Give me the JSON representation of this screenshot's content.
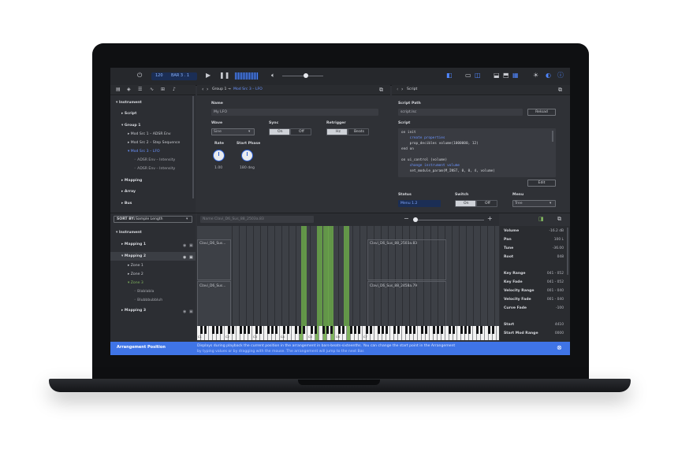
{
  "toolbar": {
    "tempo": "120",
    "signature": "BAR  3 . 1",
    "play_icon": "play-icon",
    "pause_icon": "pause-icon"
  },
  "sidebar_top": {
    "items": [
      {
        "label": "Instrument",
        "level": 0
      },
      {
        "label": "Script",
        "level": 1
      },
      {
        "label": "Group 1",
        "level": 1
      },
      {
        "label": "Mod Src 1 – ADSR Env",
        "level": 2
      },
      {
        "label": "Mod Src 2 – Step Sequence",
        "level": 2
      },
      {
        "label": "Mod Src 3 – LFO",
        "level": 2
      },
      {
        "label": "ADSR Env – Intensity",
        "level": 3
      },
      {
        "label": "ADSR Env – Intensity",
        "level": 3
      },
      {
        "label": "Mapping",
        "level": 1
      },
      {
        "label": "Array",
        "level": 1
      },
      {
        "label": "Bus",
        "level": 1
      }
    ]
  },
  "editor": {
    "breadcrumb_group": "Group 1",
    "breadcrumb_arrow": "→",
    "breadcrumb_item": "Mod Src 3 – LFO",
    "name_label": "Name",
    "name_value": "My LFO",
    "wave_label": "Wave",
    "wave_value": "Sine",
    "sync_label": "Sync",
    "sync_on": "On",
    "sync_off": "Off",
    "retrigger_label": "Retrigger",
    "retrigger_hz": "Hz",
    "retrigger_beats": "Beats",
    "rate_label": "Rate",
    "rate_value": "1.00",
    "start_phase_label": "Start Phase",
    "start_phase_value": "180 deg"
  },
  "script_panel": {
    "title": "Script",
    "path_label": "Script Path",
    "path_value": "script.lsc",
    "reload_label": "Reload",
    "script_label": "Script",
    "code": [
      {
        "text": "on init",
        "comment": false
      },
      {
        "text": "    create properties",
        "comment": true
      },
      {
        "text": "    prop_decibles volume(1000000, 12)",
        "comment": false
      },
      {
        "text": "end on",
        "comment": false
      },
      {
        "text": "",
        "comment": false
      },
      {
        "text": "on ui_control (volume)",
        "comment": false
      },
      {
        "text": "    change instrument volume",
        "comment": true
      },
      {
        "text": "    set_module_param(M_INST, 0, 0, 4, volume)",
        "comment": false
      }
    ],
    "edit_label": "Edit",
    "status_label": "Status",
    "status_value": "Menu 1.2",
    "switch_label": "Switch",
    "switch_on": "On",
    "switch_off": "Off",
    "menu_label": "Menu",
    "menu_value": "Tree"
  },
  "sort": {
    "label": "SORT BY:",
    "value": "Sample Length"
  },
  "sidebar_bottom": {
    "items": [
      {
        "label": "Instrument",
        "level": 0
      },
      {
        "label": "Mapping 1",
        "level": 1
      },
      {
        "label": "Mapping 2",
        "level": 1
      },
      {
        "label": "Zone 1",
        "level": 2
      },
      {
        "label": "Zone 2",
        "level": 2
      },
      {
        "label": "Zone 3",
        "level": 2
      },
      {
        "label": "Blablabla",
        "level": 3
      },
      {
        "label": "Blubbbubbluh",
        "level": 3
      },
      {
        "label": "Mapping 3",
        "level": 1
      }
    ]
  },
  "mapping": {
    "name_field": "Name  Clavi_D6_Sus_88_2503a.83",
    "zones": [
      "Clavi_D6_Sus...",
      "Clavi_D6_Sus_88_2503a.83",
      "Clavi_D6_Sus...",
      "Clavi_D6_Sus_88_2458a.79"
    ],
    "key_labels": [
      "C1",
      "C2",
      "C3",
      "C4",
      "C5",
      "C6",
      "C7"
    ]
  },
  "properties": {
    "items": [
      {
        "label": "Volume",
        "value": "-16.2 dB"
      },
      {
        "label": "Pan",
        "value": "100 L"
      },
      {
        "label": "Tune",
        "value": "-36.00"
      },
      {
        "label": "Root",
        "value": "048"
      },
      {
        "label": "Key Range",
        "value": "041  -  052"
      },
      {
        "label": "Key Fade",
        "value": "041  -  052"
      },
      {
        "label": "Velocity Range",
        "value": "001  -  040"
      },
      {
        "label": "Velocity Fade",
        "value": "001  -  040"
      },
      {
        "label": "Curve Fade",
        "value": "-100"
      },
      {
        "label": "Start",
        "value": "4410"
      },
      {
        "label": "Start Mod Range",
        "value": "0000"
      }
    ]
  },
  "status_bar": {
    "title": "Arrangement Position",
    "description": "Displays during playback the current position in the arrangement in bars-beats-sixteenths. You can change the start point in the Arrangement",
    "description2": "by typing values or by dragging with the mouse. The arrangement will jump to the next Bar."
  },
  "colors": {
    "accent": "#4f86ff",
    "status_bar": "#3f74e6",
    "zone_highlight": "#6aa64a"
  }
}
